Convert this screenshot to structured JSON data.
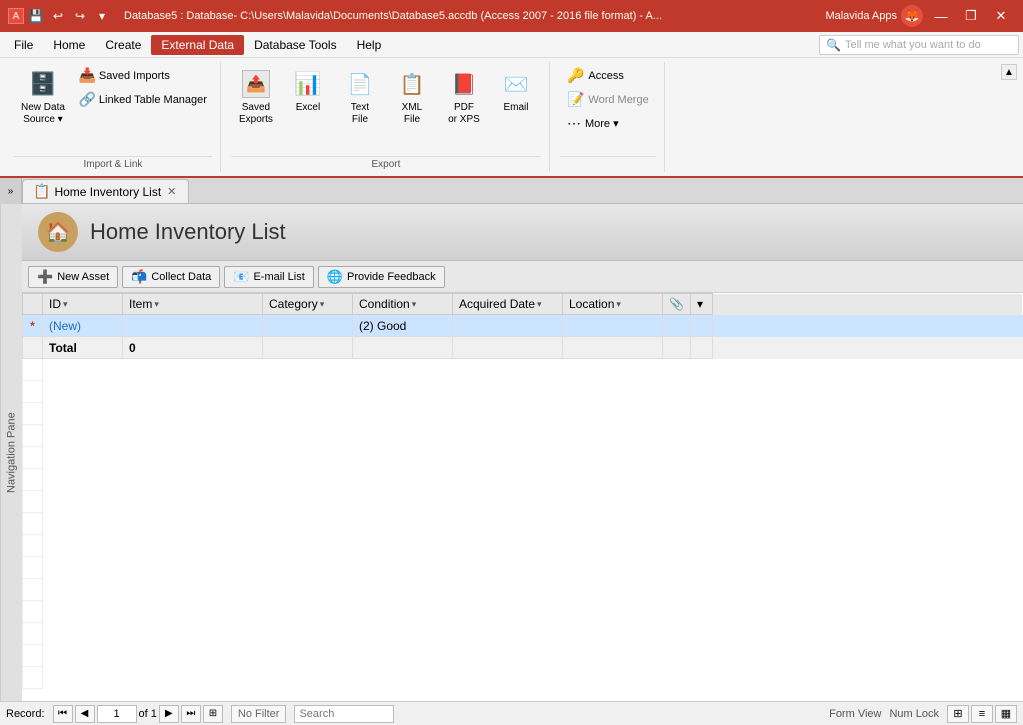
{
  "titlebar": {
    "title": "Database5 : Database- C:\\Users\\Malavida\\Documents\\Database5.accdb (Access 2007 - 2016 file format) - A...",
    "app": "Malavida Apps",
    "minimize": "—",
    "restore": "❐",
    "close": "✕"
  },
  "qat": {
    "save": "💾",
    "undo": "↩",
    "redo": "↪",
    "dropdown": "▾"
  },
  "menubar": {
    "items": [
      "File",
      "Home",
      "Create",
      "External Data",
      "Database Tools",
      "Help"
    ]
  },
  "ribbon": {
    "active_tab": "External Data",
    "groups": {
      "import_link": {
        "label": "Import & Link",
        "buttons": {
          "new_data_source": "New Data\nSource",
          "saved_imports": "Saved Imports",
          "linked_table_manager": "Linked Table Manager"
        }
      },
      "export": {
        "label": "Export",
        "buttons": {
          "saved_exports": "Saved\nExports",
          "excel": "Excel",
          "text_file": "Text\nFile",
          "xml_file": "XML\nFile",
          "pdf_xps": "PDF\nor XPS",
          "email": "Email"
        }
      },
      "access_group": {
        "label": "",
        "access_btn": "Access",
        "word_merge_btn": "Word Merge",
        "more_btn": "More ▾"
      }
    }
  },
  "document": {
    "tab_icon": "📋",
    "tab_label": "Home Inventory List",
    "form_title": "Home Inventory List",
    "toolbar": {
      "new_asset": "New Asset",
      "collect_data": "Collect Data",
      "email_list": "E-mail List",
      "provide_feedback": "Provide Feedback"
    },
    "table": {
      "columns": [
        "ID",
        "Item",
        "Category",
        "Condition",
        "Acquired Date",
        "Location"
      ],
      "rows": [
        {
          "marker": "*",
          "id": "(New)",
          "item": "",
          "category": "",
          "condition": "(2) Good",
          "acquired_date": "",
          "location": "",
          "selected": true
        },
        {
          "marker": "",
          "id": "Total",
          "item": "0",
          "category": "",
          "condition": "",
          "acquired_date": "",
          "location": "",
          "total": true
        }
      ]
    }
  },
  "statusbar": {
    "record_label": "Record:",
    "first_btn": "⏮",
    "prev_btn": "◀",
    "current": "1",
    "of_label": "of 1",
    "next_btn": "▶",
    "last_btn": "⏭",
    "new_btn": "⊞",
    "no_filter_label": "No Filter",
    "search_placeholder": "Search",
    "form_view_label": "Form View",
    "numlock_label": "Num Lock",
    "view_icons": [
      "⊞",
      "≡",
      "▦"
    ]
  },
  "navigation_pane": {
    "label": "Navigation Pane"
  },
  "icons": {
    "new_data_source": "🗄",
    "saved_imports": "📥",
    "linked_table": "🔗",
    "saved_exports": "📤",
    "excel": "📊",
    "text_file": "📄",
    "xml_file": "📋",
    "pdf_xps": "📕",
    "email": "✉",
    "access": "🔑",
    "word_merge": "📝",
    "new_asset": "➕",
    "collect_data": "📬",
    "email_list": "📧",
    "feedback": "🌐",
    "form_icon": "🏠"
  }
}
